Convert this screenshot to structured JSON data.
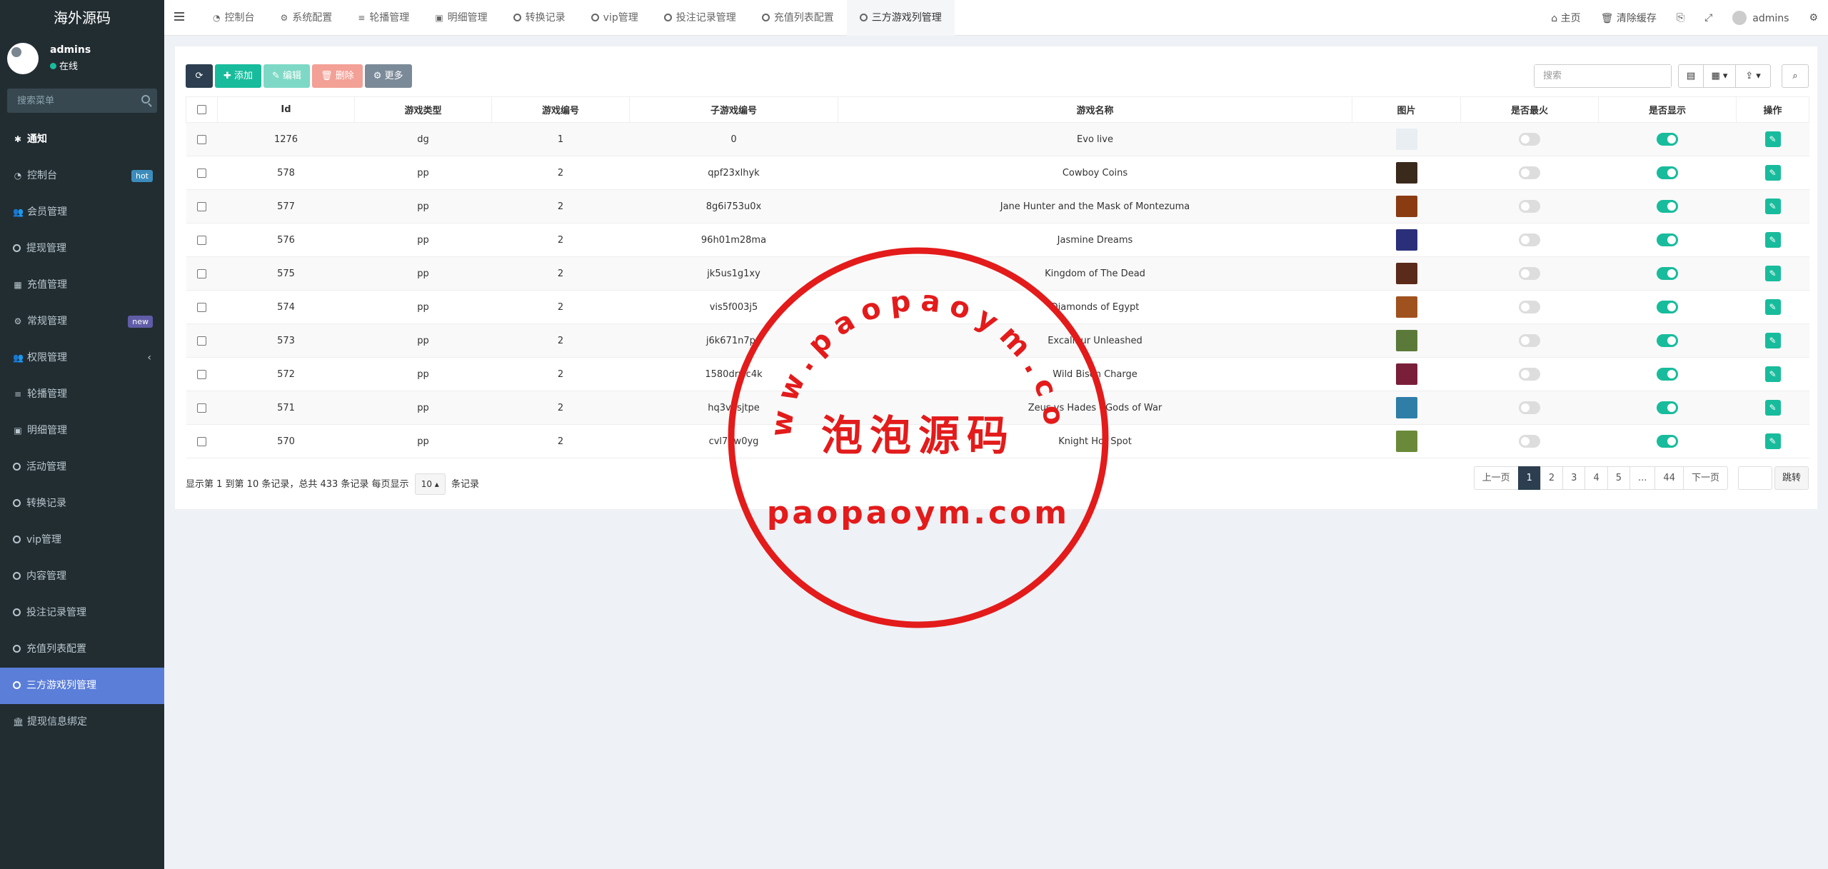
{
  "sidebar": {
    "logo": "海外源码",
    "user": {
      "name": "admins",
      "status": "在线"
    },
    "search_placeholder": "搜索菜单",
    "items": [
      {
        "label": "通知",
        "icon": "gear-icon",
        "glyph": "✱"
      },
      {
        "label": "控制台",
        "icon": "dashboard-icon",
        "glyph": "◔",
        "badge": "hot"
      },
      {
        "label": "会员管理",
        "icon": "users-icon",
        "glyph": "👥"
      },
      {
        "label": "提现管理",
        "icon": "circle-icon"
      },
      {
        "label": "充值管理",
        "icon": "grid-icon",
        "glyph": "▦"
      },
      {
        "label": "常规管理",
        "icon": "cogs-icon",
        "glyph": "⚙",
        "badge": "new"
      },
      {
        "label": "权限管理",
        "icon": "users-icon",
        "glyph": "👥",
        "arrow": "‹"
      },
      {
        "label": "轮播管理",
        "icon": "list-icon",
        "glyph": "≡"
      },
      {
        "label": "明细管理",
        "icon": "calendar-icon",
        "glyph": "▣"
      },
      {
        "label": "活动管理",
        "icon": "circle-icon"
      },
      {
        "label": "转换记录",
        "icon": "circle-icon"
      },
      {
        "label": "vip管理",
        "icon": "circle-icon"
      },
      {
        "label": "内容管理",
        "icon": "circle-icon"
      },
      {
        "label": "投注记录管理",
        "icon": "circle-icon"
      },
      {
        "label": "充值列表配置",
        "icon": "circle-icon"
      },
      {
        "label": "三方游戏列管理",
        "icon": "circle-icon"
      },
      {
        "label": "提现信息绑定",
        "icon": "bank-icon",
        "glyph": "🏛"
      }
    ]
  },
  "topbar": {
    "tabs": [
      {
        "label": "控制台",
        "icon": "dashboard-icon",
        "glyph": "◔"
      },
      {
        "label": "系统配置",
        "icon": "gear-icon",
        "glyph": "⚙"
      },
      {
        "label": "轮播管理",
        "icon": "list-icon",
        "glyph": "≡"
      },
      {
        "label": "明细管理",
        "icon": "calendar-icon",
        "glyph": "▣"
      },
      {
        "label": "转换记录",
        "icon": "circle-icon"
      },
      {
        "label": "vip管理",
        "icon": "circle-icon"
      },
      {
        "label": "投注记录管理",
        "icon": "circle-icon"
      },
      {
        "label": "充值列表配置",
        "icon": "circle-icon"
      },
      {
        "label": "三方游戏列管理",
        "icon": "circle-icon"
      }
    ],
    "right": {
      "home": "主页",
      "clear_cache": "清除缓存",
      "user": "admins"
    }
  },
  "toolbar": {
    "refresh_glyph": "⟳",
    "add": "✚ 添加",
    "edit": "✎ 编辑",
    "delete": "🗑 删除",
    "more": "⚙ 更多",
    "search_placeholder": "搜索"
  },
  "table": {
    "columns": [
      "Id",
      "游戏类型",
      "游戏编号",
      "子游戏编号",
      "游戏名称",
      "图片",
      "是否最火",
      "是否显示",
      "操作"
    ],
    "rows": [
      {
        "id": "1276",
        "type": "dg",
        "game_no": "1",
        "sub_no": "0",
        "name": "Evo live",
        "thumb": "#e9eef3",
        "hot": false,
        "show": true
      },
      {
        "id": "578",
        "type": "pp",
        "game_no": "2",
        "sub_no": "qpf23xlhyk",
        "name": "Cowboy Coins",
        "thumb": "#3a2a1c",
        "hot": false,
        "show": true
      },
      {
        "id": "577",
        "type": "pp",
        "game_no": "2",
        "sub_no": "8g6i753u0x",
        "name": "Jane Hunter and the Mask of Montezuma",
        "thumb": "#8a3b12",
        "hot": false,
        "show": true
      },
      {
        "id": "576",
        "type": "pp",
        "game_no": "2",
        "sub_no": "96h01m28ma",
        "name": "Jasmine Dreams",
        "thumb": "#2b2f7a",
        "hot": false,
        "show": true
      },
      {
        "id": "575",
        "type": "pp",
        "game_no": "2",
        "sub_no": "jk5us1g1xy",
        "name": "Kingdom of The Dead",
        "thumb": "#5a2a1a",
        "hot": false,
        "show": true
      },
      {
        "id": "574",
        "type": "pp",
        "game_no": "2",
        "sub_no": "vis5f003j5",
        "name": "Diamonds of Egypt",
        "thumb": "#a0521e",
        "hot": false,
        "show": true
      },
      {
        "id": "573",
        "type": "pp",
        "game_no": "2",
        "sub_no": "j6k671n7pu",
        "name": "Excalibur Unleashed",
        "thumb": "#5b7a3a",
        "hot": false,
        "show": true
      },
      {
        "id": "572",
        "type": "pp",
        "game_no": "2",
        "sub_no": "1580drwc4k",
        "name": "Wild Bison Charge",
        "thumb": "#7a1f3a",
        "hot": false,
        "show": true
      },
      {
        "id": "571",
        "type": "pp",
        "game_no": "2",
        "sub_no": "hq3v7sjtpe",
        "name": "Zeus vs Hades - Gods of War",
        "thumb": "#2f7ea8",
        "hot": false,
        "show": true
      },
      {
        "id": "570",
        "type": "pp",
        "game_no": "2",
        "sub_no": "cvl7hw0yg",
        "name": "Knight Hot Spot",
        "thumb": "#6a8a3a",
        "hot": false,
        "show": true
      }
    ]
  },
  "footer": {
    "info_prefix": "显示第 1 到第 10 条记录，总共 433 条记录 每页显示",
    "page_size": "10 ▴",
    "info_suffix": "条记录",
    "pager": [
      "上一页",
      "1",
      "2",
      "3",
      "4",
      "5",
      "...",
      "44",
      "下一页"
    ],
    "active_page": "1",
    "go": "跳转"
  },
  "watermark": {
    "url_arc": "www.paopaoym.com",
    "title": "泡泡源码",
    "domain": "paopaoym.com",
    "color": "#e31b1b"
  }
}
